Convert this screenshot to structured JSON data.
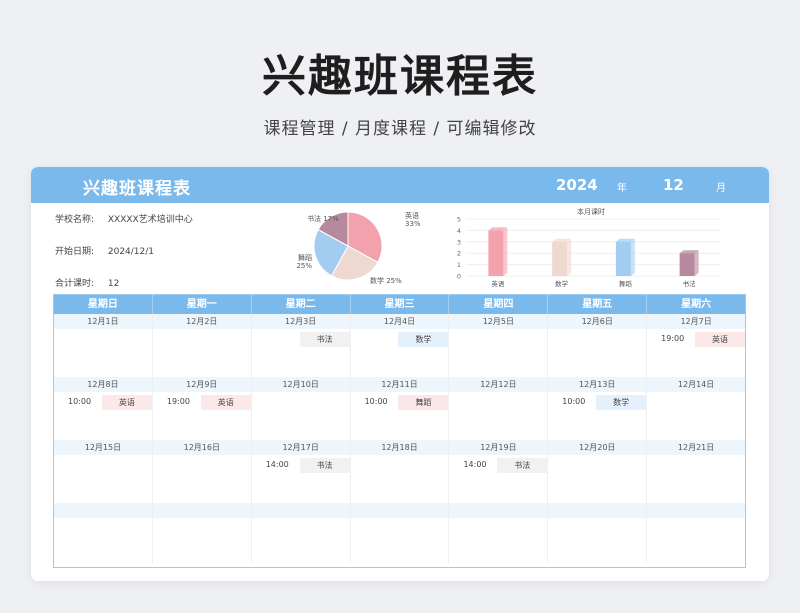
{
  "page": {
    "title": "兴趣班课程表",
    "subtitle": "课程管理 / 月度课程 / 可编辑修改"
  },
  "card": {
    "title": "兴趣班课程表",
    "year": "2024",
    "year_unit": "年",
    "month": "12",
    "month_unit": "月"
  },
  "info": {
    "school_label": "学校名称:",
    "school_value": "XXXXX艺术培训中心",
    "start_label": "开始日期:",
    "start_value": "2024/12/1",
    "total_label": "合计课时:",
    "total_value": "12"
  },
  "colors": {
    "header": "#7ab9ec",
    "english": "#f4a1ae",
    "math": "#edd9d0",
    "dance": "#a3cdf0",
    "calligraphy": "#b6899f"
  },
  "chart_data": [
    {
      "type": "pie",
      "categories": [
        "英语",
        "数学",
        "舞蹈",
        "书法"
      ],
      "values": [
        33,
        25,
        25,
        17
      ],
      "labels": [
        "英语\n33%",
        "数学 25%",
        "舞蹈\n25%",
        "书法 17%"
      ]
    },
    {
      "type": "bar",
      "title": "本月课时",
      "categories": [
        "英语",
        "数学",
        "舞蹈",
        "书法"
      ],
      "values": [
        4,
        3,
        3,
        2
      ],
      "ylim": [
        0,
        5
      ],
      "yticks": [
        "0",
        "1",
        "2",
        "3",
        "4",
        "5"
      ]
    }
  ],
  "calendar": {
    "weekdays": [
      "星期日",
      "星期一",
      "星期二",
      "星期三",
      "星期四",
      "星期五",
      "星期六"
    ],
    "weeks": [
      [
        {
          "date": "12月1日"
        },
        {
          "date": "12月2日"
        },
        {
          "date": "12月3日",
          "time": "",
          "subject": "书法",
          "cls": "c-calli"
        },
        {
          "date": "12月4日",
          "time": "",
          "subject": "数学",
          "cls": "c-math"
        },
        {
          "date": "12月5日"
        },
        {
          "date": "12月6日"
        },
        {
          "date": "12月7日",
          "time": "19:00",
          "subject": "英语",
          "cls": "c-en"
        }
      ],
      [
        {
          "date": "12月8日",
          "time": "10:00",
          "subject": "英语",
          "cls": "c-en"
        },
        {
          "date": "12月9日",
          "time": "19:00",
          "subject": "英语",
          "cls": "c-en"
        },
        {
          "date": "12月10日"
        },
        {
          "date": "12月11日",
          "time": "10:00",
          "subject": "舞蹈",
          "cls": "c-dance"
        },
        {
          "date": "12月12日"
        },
        {
          "date": "12月13日",
          "time": "10:00",
          "subject": "数学",
          "cls": "c-math"
        },
        {
          "date": "12月14日"
        }
      ],
      [
        {
          "date": "12月15日"
        },
        {
          "date": "12月16日"
        },
        {
          "date": "12月17日",
          "time": "14:00",
          "subject": "书法",
          "cls": "c-calli"
        },
        {
          "date": "12月18日"
        },
        {
          "date": "12月19日",
          "time": "14:00",
          "subject": "书法",
          "cls": "c-calli"
        },
        {
          "date": "12月20日"
        },
        {
          "date": "12月21日"
        }
      ],
      [
        {
          "date": ""
        },
        {
          "date": ""
        },
        {
          "date": ""
        },
        {
          "date": ""
        },
        {
          "date": ""
        },
        {
          "date": ""
        },
        {
          "date": ""
        }
      ]
    ]
  }
}
